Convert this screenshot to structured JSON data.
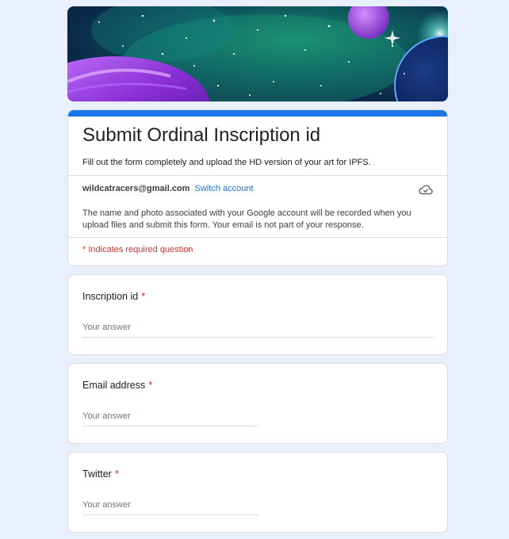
{
  "form": {
    "title": "Submit Ordinal Inscription id",
    "description": "Fill out the form completely and upload the HD version of your art for IPFS.",
    "account_email": "wildcatracers@gmail.com",
    "switch_account": "Switch account",
    "notice": "The name and photo associated with your Google account will be recorded when you upload files and submit this form. Your email is not part of your response.",
    "required_note": "* Indicates required question"
  },
  "questions": [
    {
      "label": "Inscription id",
      "required_mark": "*",
      "placeholder": "Your answer",
      "value": ""
    },
    {
      "label": "Email address",
      "required_mark": "*",
      "placeholder": "Your answer",
      "value": ""
    },
    {
      "label": "Twitter",
      "required_mark": "*",
      "placeholder": "Your answer",
      "value": ""
    }
  ],
  "colors": {
    "page_background": "#e8f0fe",
    "accent": "#1a73e8",
    "required": "#d93025"
  },
  "icons": {
    "cloud": "cloud-saved-icon"
  }
}
